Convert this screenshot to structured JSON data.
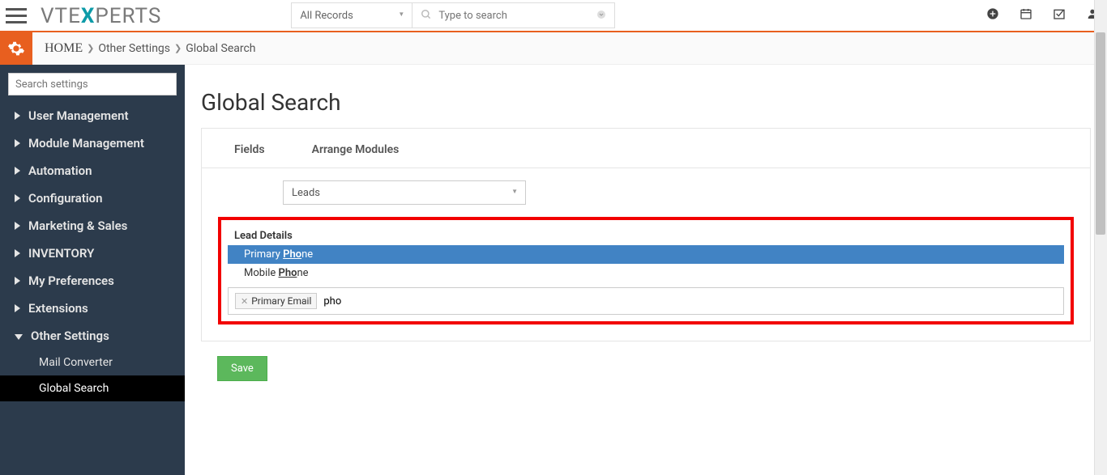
{
  "header": {
    "logo_pre": "VTE",
    "logo_x": "X",
    "logo_post": "PERTS",
    "records_select": "All Records",
    "search_placeholder": "Type to search"
  },
  "breadcrumb": {
    "home": "HOME",
    "level1": "Other Settings",
    "level2": "Global Search"
  },
  "sidebar": {
    "search_placeholder": "Search settings",
    "items": [
      {
        "label": "User Management"
      },
      {
        "label": "Module Management"
      },
      {
        "label": "Automation"
      },
      {
        "label": "Configuration"
      },
      {
        "label": "Marketing & Sales"
      },
      {
        "label": "INVENTORY"
      },
      {
        "label": "My Preferences"
      },
      {
        "label": "Extensions"
      },
      {
        "label": "Other Settings"
      }
    ],
    "subitems": [
      {
        "label": "Mail Converter"
      },
      {
        "label": "Global Search"
      }
    ]
  },
  "main": {
    "title": "Global Search",
    "tabs": [
      {
        "label": "Fields"
      },
      {
        "label": "Arrange Modules"
      }
    ],
    "module_select": "Leads",
    "group_header": "Lead Details",
    "options": [
      {
        "pre": "Primary ",
        "match": "Pho",
        "post": "ne"
      },
      {
        "pre": "Mobile ",
        "match": "Pho",
        "post": "ne"
      }
    ],
    "tag": "Primary Email",
    "typed": "pho",
    "save": "Save"
  }
}
